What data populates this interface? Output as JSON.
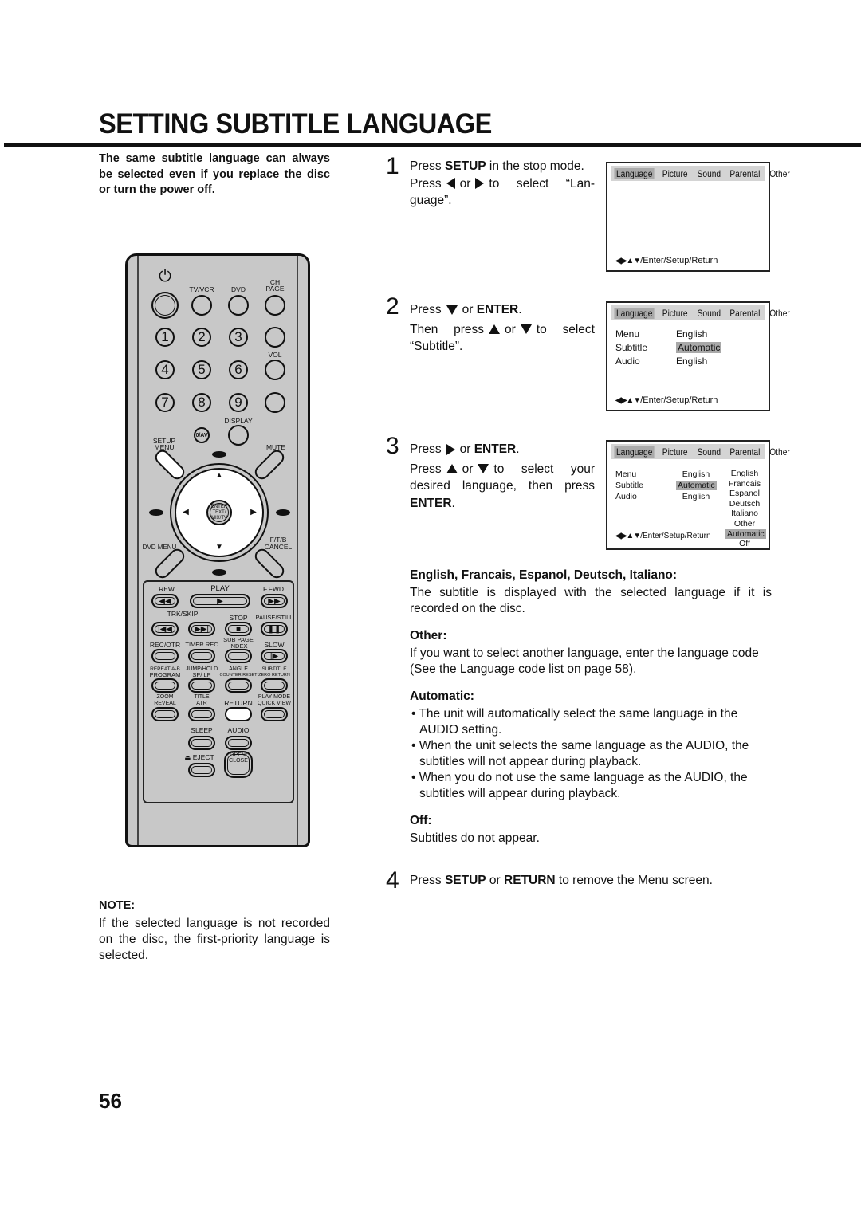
{
  "title": "SETTING SUBTITLE LANGUAGE",
  "intro": "The same subtitle language can always be selected even if you replace the disc or turn the power off.",
  "steps": [
    {
      "num": "1",
      "line1_a": "Press ",
      "line1_b": "SETUP",
      "line1_c": " in the stop mode.",
      "line2_a": "Press",
      "line2_b": "or",
      "line2_c": "to select “Lan-guage”."
    },
    {
      "num": "2",
      "line1_a": "Press",
      "line1_b": "or ",
      "line1_c": "ENTER",
      "line1_d": ".",
      "line2_a": "Then press",
      "line2_b": "or",
      "line2_c": "to select “Subtitle”."
    },
    {
      "num": "3",
      "line1_a": "Press",
      "line1_b": "or ",
      "line1_c": "ENTER",
      "line1_d": ".",
      "line2_a": "Press",
      "line2_b": "or",
      "line2_c": "to select your desired language, then press ",
      "line2_d": "ENTER",
      "line2_e": "."
    },
    {
      "num": "4",
      "a": "Press ",
      "b": "SETUP",
      "c": " or ",
      "d": "RETURN",
      "e": " to remove the Menu screen."
    }
  ],
  "screen": {
    "tabs": [
      "Language",
      "Picture",
      "Sound",
      "Parental",
      "Other"
    ],
    "nav": "/Enter/Setup/Return",
    "rows": [
      {
        "label": "Menu",
        "value": "English"
      },
      {
        "label": "Subtitle",
        "value": "Automatic"
      },
      {
        "label": "Audio",
        "value": "English"
      }
    ],
    "options": [
      "English",
      "Francais",
      "Espanol",
      "Deutsch",
      "Italiano",
      "Other",
      "Automatic",
      "Off"
    ]
  },
  "sections": {
    "h1": "English, Francais, Espanol, Deutsch, Italiano:",
    "t1": "The subtitle is displayed with the selected language if it is recorded on the disc.",
    "h2": "Other:",
    "t2": "If you want to select another language, enter the language code (See the Language code list on page 58).",
    "h3": "Automatic:",
    "b1": "• The unit will automatically select the same language in the AUDIO setting.",
    "b2": "• When the unit selects the same language as the AUDIO, the subtitles will not appear during playback.",
    "b3": "• When you do not use the same language as the AUDIO, the subtitles will appear during playback.",
    "h4": "Off:",
    "t4": "Subtitles do not appear."
  },
  "note": {
    "heading": "NOTE:",
    "text": "If the selected language is not recorded on the disc, the first-priority language is selected."
  },
  "page_number": "56",
  "remote": {
    "tvvcr": "TV/VCR",
    "dvd": "DVD",
    "ch": "CH",
    "page": "PAGE",
    "vol": "VOL",
    "display": "DISPLAY",
    "oav": "0/AV",
    "setup": "SETUP",
    "menu": "MENU",
    "mute": "MUTE",
    "enter": "ENTER",
    "text": "TEXT/",
    "mixtv": "MIX/TV",
    "dvdmenu": "DVD MENU",
    "ftb": "F/T/B",
    "cancel": "CANCEL",
    "digits": [
      "1",
      "2",
      "3",
      "4",
      "5",
      "6",
      "7",
      "8",
      "9"
    ],
    "rew": "REW",
    "play": "PLAY",
    "ffwd": "F.FWD",
    "trk": "TRK/SKIP",
    "stop": "STOP",
    "pause": "PAUSE/STILL",
    "recotr": "REC/OTR",
    "timerrec": "TIMER REC",
    "subpage": "SUB PAGE",
    "index": "INDEX",
    "slow": "SLOW",
    "repeat": "REPEAT A-B",
    "program": "PROGRAM",
    "jump": "JUMP/HOLD",
    "splp": "SP/ LP",
    "angle": "ANGLE",
    "counter": "COUNTER RESET",
    "subtitle": "SUBTITLE",
    "zero": "ZERO RETURN",
    "zoom": "ZOOM",
    "reveal": "REVEAL",
    "ttl": "TITLE",
    "atr": "ATR",
    "ret": "RETURN",
    "playmode": "PLAY MODE",
    "quick": "QUICK VIEW",
    "sleep": "SLEEP",
    "audio": "AUDIO",
    "eject": "⏏ EJECT",
    "open": "OPEN/",
    "close": "CLOSE"
  }
}
